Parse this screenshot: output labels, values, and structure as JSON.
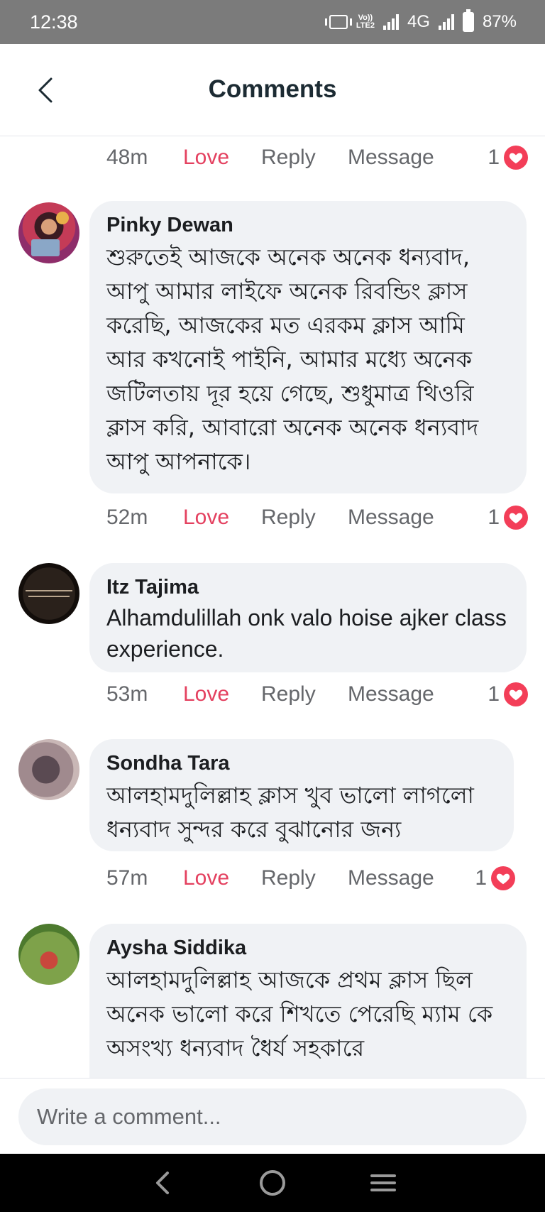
{
  "status_bar": {
    "time": "12:38",
    "volte": "Vo))\nLTE2",
    "network": "4G",
    "battery": "87%"
  },
  "header": {
    "title": "Comments",
    "back_icon": "chevron-left-icon"
  },
  "comments": [
    {
      "author": "",
      "text": "",
      "meta": {
        "time": "48m",
        "love": "Love",
        "reply": "Reply",
        "message": "Message",
        "count": "1"
      }
    },
    {
      "author": "Pinky Dewan",
      "text": "শুরুতেই আজকে অনেক অনেক ধন্যবাদ, আপু আমার লাইফে অনেক রিবন্ডিং ক্লাস করেছি, আজকের মত এরকম ক্লাস আমি আর কখনোই পাইনি, আমার মধ্যে অনেক জটিলতায় দূর হয়ে গেছে, শুধুমাত্র থিওরি ক্লাস করি, আবারো অনেক অনেক ধন্যবাদ আপু আপনাকে।",
      "meta": {
        "time": "52m",
        "love": "Love",
        "reply": "Reply",
        "message": "Message",
        "count": "1"
      }
    },
    {
      "author": "Itz Tajima",
      "text": "Alhamdulillah onk valo hoise ajker class experience.",
      "meta": {
        "time": "53m",
        "love": "Love",
        "reply": "Reply",
        "message": "Message",
        "count": "1"
      }
    },
    {
      "author": "Sondha Tara",
      "text": "আলহামদুলিল্লাহ ক্লাস খুব ভালো লাগলো ধন্যবাদ সুন্দর করে বুঝানোর জন্য",
      "meta": {
        "time": "57m",
        "love": "Love",
        "reply": "Reply",
        "message": "Message",
        "count": "1"
      }
    },
    {
      "author": "Aysha Siddika",
      "text": "আলহামদুলিল্লাহ আজকে প্রথম ক্লাস ছিল অনেক ভালো করে শিখতে পেরেছি ম্যাম কে অসংখ্য ধন্যবাদ ধৈর্য সহকারে",
      "meta": {}
    }
  ],
  "composer": {
    "placeholder": "Write a comment..."
  },
  "colors": {
    "love": "#e4405f",
    "bubble": "#f0f2f5",
    "heart_badge": "#f33e58"
  }
}
